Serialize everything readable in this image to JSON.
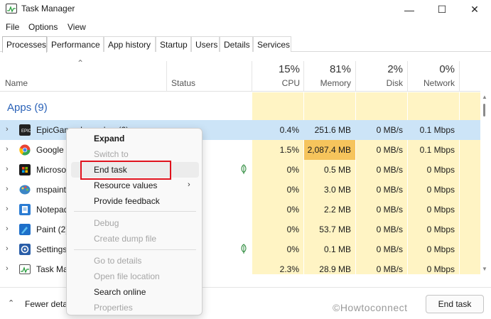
{
  "window": {
    "title": "Task Manager",
    "minimize": "—",
    "maximize": "☐",
    "close": "✕"
  },
  "menu": [
    "File",
    "Options",
    "View"
  ],
  "tabs": [
    "Processes",
    "Performance",
    "App history",
    "Startup",
    "Users",
    "Details",
    "Services"
  ],
  "columns": {
    "name": "Name",
    "status": "Status",
    "cpu": {
      "pct": "15%",
      "label": "CPU"
    },
    "memory": {
      "pct": "81%",
      "label": "Memory"
    },
    "disk": {
      "pct": "2%",
      "label": "Disk"
    },
    "network": {
      "pct": "0%",
      "label": "Network"
    }
  },
  "group": "Apps (9)",
  "rows": [
    {
      "name": "EpicGamesLauncher (6)",
      "cpu": "0.4%",
      "memory": "251.6 MB",
      "disk": "0 MB/s",
      "network": "0.1 Mbps",
      "icon": "epic-games-icon"
    },
    {
      "name": "Google Chrome",
      "cpu": "1.5%",
      "memory": "2,087.4 MB",
      "disk": "0 MB/s",
      "network": "0.1 Mbps",
      "icon": "chrome-icon"
    },
    {
      "name": "Microsoft Store",
      "cpu": "0%",
      "memory": "0.5 MB",
      "disk": "0 MB/s",
      "network": "0 Mbps",
      "icon": "store-icon"
    },
    {
      "name": "mspaint",
      "cpu": "0%",
      "memory": "3.0 MB",
      "disk": "0 MB/s",
      "network": "0 Mbps",
      "icon": "mspaint-icon"
    },
    {
      "name": "Notepad",
      "cpu": "0%",
      "memory": "2.2 MB",
      "disk": "0 MB/s",
      "network": "0 Mbps",
      "icon": "notepad-icon"
    },
    {
      "name": "Paint (2)",
      "cpu": "0%",
      "memory": "53.7 MB",
      "disk": "0 MB/s",
      "network": "0 Mbps",
      "icon": "paint-icon"
    },
    {
      "name": "Settings",
      "cpu": "0%",
      "memory": "0.1 MB",
      "disk": "0 MB/s",
      "network": "0 Mbps",
      "icon": "settings-icon"
    },
    {
      "name": "Task Manager",
      "cpu": "2.3%",
      "memory": "28.9 MB",
      "disk": "0 MB/s",
      "network": "0 Mbps",
      "icon": "task-manager-icon"
    }
  ],
  "context_menu": {
    "expand": "Expand",
    "switch_to": "Switch to",
    "end_task": "End task",
    "resource_values": "Resource values",
    "provide_feedback": "Provide feedback",
    "debug": "Debug",
    "create_dump": "Create dump file",
    "go_to_details": "Go to details",
    "open_file_location": "Open file location",
    "search_online": "Search online",
    "properties": "Properties"
  },
  "footer": {
    "fewer_details": "Fewer details",
    "end_task": "End task",
    "watermark": "©Howtoconnect"
  },
  "colors": {
    "accent": "#2a62b8",
    "heat_light": "#fff4c4",
    "heat_high": "#f6c45c",
    "selected": "#cce4f7",
    "annotation": "#e0121d"
  }
}
